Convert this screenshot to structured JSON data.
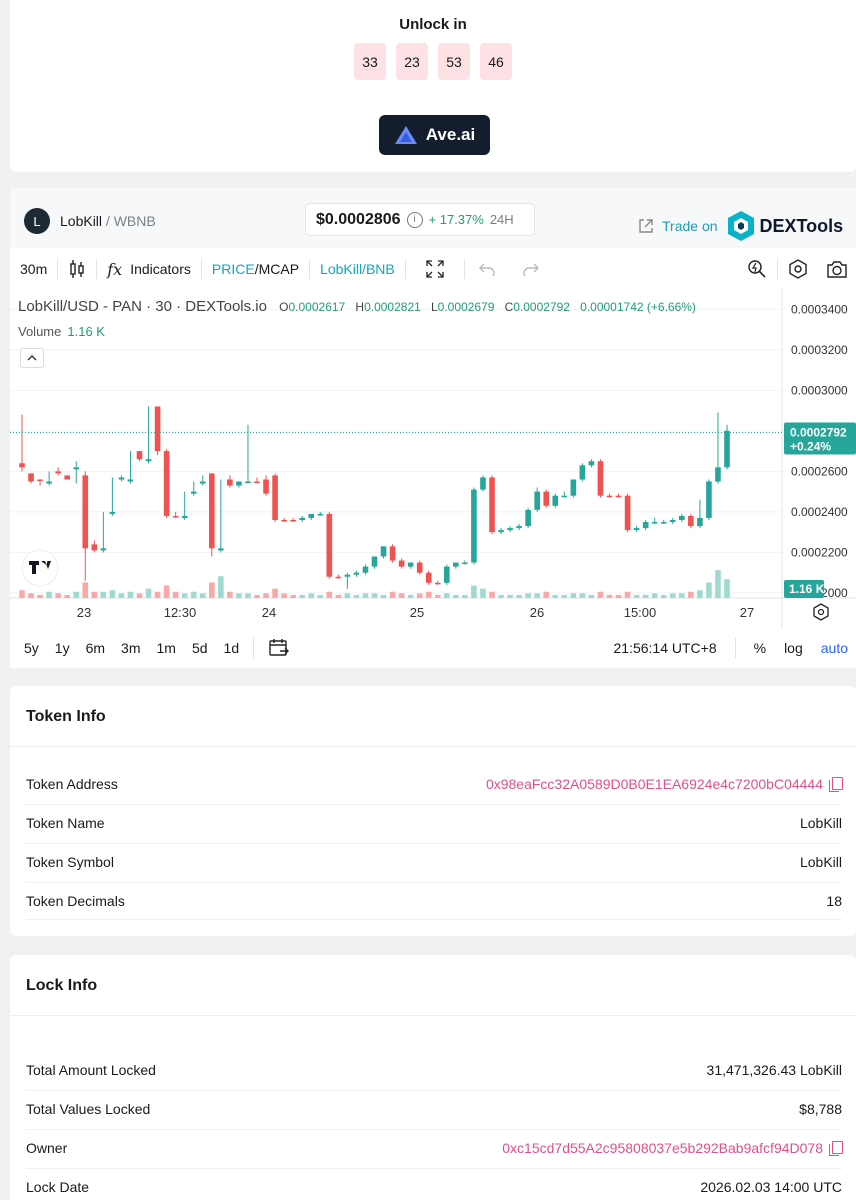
{
  "unlock": {
    "title": "Unlock in",
    "countdown": [
      "33",
      "23",
      "53",
      "46"
    ],
    "button_label": "Ave.ai"
  },
  "pair": {
    "logo_letter": "L",
    "base": "LobKill",
    "quote": "/ WBNB",
    "price": "$0.0002806",
    "change": "+ 17.37%",
    "period": "24H",
    "trade_on_label": "Trade on",
    "dextools_label": "DEXTools"
  },
  "toolbar": {
    "interval": "30m",
    "indicators_label": "Indicators",
    "price_label": "PRICE",
    "mcap_label": "/MCAP",
    "pair_label": "LobKill/BNB"
  },
  "legend": {
    "symbol": "LobKill/USD - PAN · 30 · DEXTools.io",
    "o_label": "O",
    "o": "0.0002617",
    "h_label": "H",
    "h": "0.0002821",
    "l_label": "L",
    "l": "0.0002679",
    "c_label": "C",
    "c": "0.0002792",
    "change": "0.00001742 (+6.66%)",
    "volume_label": "Volume",
    "volume_value": "1.16 K"
  },
  "chart_data": {
    "type": "candlestick",
    "y_ticks": [
      "0.0003400",
      "0.0003200",
      "0.0003000",
      "0.0002800",
      "0.0002600",
      "0.0002400",
      "0.0002200",
      "0.0002000"
    ],
    "x_ticks": [
      "23",
      "12:30",
      "24",
      "25",
      "26",
      "15:00",
      "27"
    ],
    "last_price_label": "0.0002792",
    "last_change_label": "+0.24%",
    "volume_label": "1.16 K",
    "ylim": [
      0.0001975,
      0.0003505
    ],
    "colors": {
      "up": "#26a69a",
      "down": "#ef5350",
      "vol_up": "#9fd9cf",
      "vol_down": "#f7a9a7"
    },
    "candles": [
      [
        0.000264,
        0.000288,
        0.000262,
        0.00026,
        "d"
      ],
      [
        0.000259,
        0.000258,
        0.000255,
        0.000254,
        "d"
      ],
      [
        0.000256,
        0.000256,
        0.000256,
        0.000253,
        "d"
      ],
      [
        0.000255,
        0.00026,
        0.000254,
        0.000253,
        "u"
      ],
      [
        0.00026,
        0.000262,
        0.000259,
        0.000258,
        "d"
      ],
      [
        0.000258,
        0.000258,
        0.000256,
        0.000256,
        "d"
      ],
      [
        0.000262,
        0.000265,
        0.000261,
        0.000254,
        "u"
      ],
      [
        0.000258,
        0.00026,
        0.000222,
        0.000206,
        "d"
      ],
      [
        0.000224,
        0.000226,
        0.000221,
        0.00022,
        "d"
      ],
      [
        0.000222,
        0.00024,
        0.000221,
        0.00022,
        "u"
      ],
      [
        0.00024,
        0.000257,
        0.000239,
        0.000238,
        "u"
      ],
      [
        0.000257,
        0.000258,
        0.000256,
        0.000255,
        "u"
      ],
      [
        0.000256,
        0.00027,
        0.000255,
        0.000254,
        "u"
      ],
      [
        0.00027,
        0.00027,
        0.000266,
        0.000265,
        "d"
      ],
      [
        0.000266,
        0.000292,
        0.000265,
        0.000264,
        "u"
      ],
      [
        0.000292,
        0.000292,
        0.00027,
        0.000268,
        "d"
      ],
      [
        0.00027,
        0.000271,
        0.000238,
        0.000237,
        "d"
      ],
      [
        0.000238,
        0.00024,
        0.000238,
        0.000237,
        "d"
      ],
      [
        0.000238,
        0.00025,
        0.000237,
        0.000236,
        "u"
      ],
      [
        0.00025,
        0.000255,
        0.000249,
        0.000248,
        "u"
      ],
      [
        0.000255,
        0.000258,
        0.000254,
        0.000253,
        "u"
      ],
      [
        0.000259,
        0.000259,
        0.000222,
        0.000218,
        "d"
      ],
      [
        0.000222,
        0.000256,
        0.000221,
        0.00022,
        "u"
      ],
      [
        0.000256,
        0.000258,
        0.000253,
        0.000252,
        "d"
      ],
      [
        0.000253,
        0.000255,
        0.000255,
        0.000252,
        "u"
      ],
      [
        0.000255,
        0.000283,
        0.000255,
        0.000254,
        "u"
      ],
      [
        0.000255,
        0.000257,
        0.000255,
        0.000254,
        "d"
      ],
      [
        0.000256,
        0.000258,
        0.000249,
        0.000248,
        "d"
      ],
      [
        0.000258,
        0.000259,
        0.000236,
        0.000235,
        "d"
      ],
      [
        0.000236,
        0.000237,
        0.000236,
        0.000235,
        "d"
      ],
      [
        0.000236,
        0.000237,
        0.000236,
        0.000235,
        "d"
      ],
      [
        0.000236,
        0.000238,
        0.000237,
        0.000235,
        "u"
      ],
      [
        0.000237,
        0.000239,
        0.000239,
        0.000236,
        "u"
      ],
      [
        0.000239,
        0.00024,
        0.000239,
        0.000238,
        "u"
      ],
      [
        0.000239,
        0.00024,
        0.000208,
        0.000207,
        "d"
      ],
      [
        0.000208,
        0.000209,
        0.000208,
        0.000207,
        "d"
      ],
      [
        0.000208,
        0.00021,
        0.000209,
        0.000202,
        "u"
      ],
      [
        0.000209,
        0.000211,
        0.00021,
        0.000208,
        "u"
      ],
      [
        0.00021,
        0.000214,
        0.000213,
        0.000209,
        "u"
      ],
      [
        0.000213,
        0.000218,
        0.000218,
        0.000212,
        "u"
      ],
      [
        0.000218,
        0.000223,
        0.000223,
        0.000217,
        "u"
      ],
      [
        0.000223,
        0.000224,
        0.000216,
        0.000215,
        "d"
      ],
      [
        0.000216,
        0.000217,
        0.000213,
        0.000212,
        "d"
      ],
      [
        0.000213,
        0.000215,
        0.000215,
        0.000212,
        "u"
      ],
      [
        0.000215,
        0.000216,
        0.00021,
        0.000209,
        "d"
      ],
      [
        0.00021,
        0.000211,
        0.000205,
        0.000204,
        "d"
      ],
      [
        0.000205,
        0.000206,
        0.000205,
        0.000204,
        "d"
      ],
      [
        0.000205,
        0.000214,
        0.000213,
        0.000204,
        "u"
      ],
      [
        0.000213,
        0.000215,
        0.000215,
        0.000212,
        "u"
      ],
      [
        0.000215,
        0.000216,
        0.000215,
        0.000214,
        "u"
      ],
      [
        0.000215,
        0.000252,
        0.000251,
        0.000214,
        "u"
      ],
      [
        0.000251,
        0.000258,
        0.000257,
        0.00025,
        "u"
      ],
      [
        0.000257,
        0.000258,
        0.00023,
        0.000229,
        "d"
      ],
      [
        0.00023,
        0.000232,
        0.000231,
        0.000229,
        "u"
      ],
      [
        0.000231,
        0.000233,
        0.000232,
        0.00023,
        "u"
      ],
      [
        0.000232,
        0.000234,
        0.000233,
        0.000231,
        "u"
      ],
      [
        0.000233,
        0.000242,
        0.000241,
        0.000232,
        "u"
      ],
      [
        0.000241,
        0.000252,
        0.00025,
        0.00024,
        "u"
      ],
      [
        0.00025,
        0.000251,
        0.000243,
        0.000242,
        "d"
      ],
      [
        0.000243,
        0.000249,
        0.000248,
        0.000242,
        "u"
      ],
      [
        0.000248,
        0.00025,
        0.000248,
        0.000247,
        "u"
      ],
      [
        0.000248,
        0.000256,
        0.000256,
        0.000247,
        "u"
      ],
      [
        0.000256,
        0.000264,
        0.000263,
        0.000255,
        "u"
      ],
      [
        0.000263,
        0.000266,
        0.000265,
        0.000262,
        "u"
      ],
      [
        0.000265,
        0.000266,
        0.000248,
        0.000247,
        "d"
      ],
      [
        0.000248,
        0.000249,
        0.000248,
        0.000247,
        "d"
      ],
      [
        0.000248,
        0.000249,
        0.000248,
        0.000247,
        "d"
      ],
      [
        0.000248,
        0.000249,
        0.000231,
        0.00023,
        "d"
      ],
      [
        0.000231,
        0.000233,
        0.000232,
        0.00023,
        "u"
      ],
      [
        0.000232,
        0.000236,
        0.000235,
        0.000231,
        "u"
      ],
      [
        0.000235,
        0.000237,
        0.000235,
        0.000234,
        "u"
      ],
      [
        0.000235,
        0.000236,
        0.000235,
        0.000234,
        "u"
      ],
      [
        0.000235,
        0.000237,
        0.000236,
        0.000234,
        "u"
      ],
      [
        0.000236,
        0.000239,
        0.000238,
        0.000235,
        "u"
      ],
      [
        0.000238,
        0.000239,
        0.000233,
        0.000232,
        "d"
      ],
      [
        0.000233,
        0.000246,
        0.000237,
        0.000232,
        "u"
      ],
      [
        0.000237,
        0.000256,
        0.000255,
        0.000236,
        "u"
      ],
      [
        0.000255,
        0.000289,
        0.000262,
        0.000254,
        "u"
      ],
      [
        0.000262,
        0.000283,
        0.00028,
        0.000261,
        "u"
      ]
    ],
    "volumes": [
      5,
      3,
      2,
      4,
      3,
      2,
      4,
      10,
      4,
      4,
      5,
      3,
      4,
      3,
      6,
      4,
      8,
      4,
      3,
      4,
      3,
      10,
      14,
      4,
      3,
      3,
      2,
      3,
      6,
      3,
      2,
      2,
      3,
      2,
      4,
      2,
      3,
      2,
      3,
      3,
      2,
      4,
      3,
      2,
      3,
      4,
      2,
      3,
      2,
      2,
      8,
      6,
      4,
      2,
      2,
      2,
      3,
      3,
      4,
      2,
      2,
      3,
      3,
      2,
      4,
      2,
      2,
      4,
      2,
      2,
      3,
      2,
      3,
      3,
      4,
      5,
      10,
      18,
      12
    ]
  },
  "range_bar": {
    "ranges": [
      "5y",
      "1y",
      "6m",
      "3m",
      "1m",
      "5d",
      "1d"
    ],
    "time": "21:56:14 UTC+8",
    "percent": "%",
    "log": "log",
    "auto": "auto"
  },
  "token_info": {
    "title": "Token Info",
    "rows": [
      {
        "label": "Token Address",
        "value": "0x98eaFcc32A0589D0B0E1EA6924e4c7200bC04444"
      },
      {
        "label": "Token Name",
        "value": "LobKill"
      },
      {
        "label": "Token Symbol",
        "value": "LobKill"
      },
      {
        "label": "Token Decimals",
        "value": "18"
      }
    ]
  },
  "lock_info": {
    "title": "Lock Info",
    "rows": [
      {
        "label": "Total Amount Locked",
        "value": "31,471,326.43 LobKill"
      },
      {
        "label": "Total Values Locked",
        "value": "$8,788"
      },
      {
        "label": "Owner",
        "value": "0xc15cd7d55A2c95808037e5b292Bab9afcf94D078"
      },
      {
        "label": "Lock Date",
        "value": "2026.02.03 14:00 UTC"
      }
    ]
  }
}
